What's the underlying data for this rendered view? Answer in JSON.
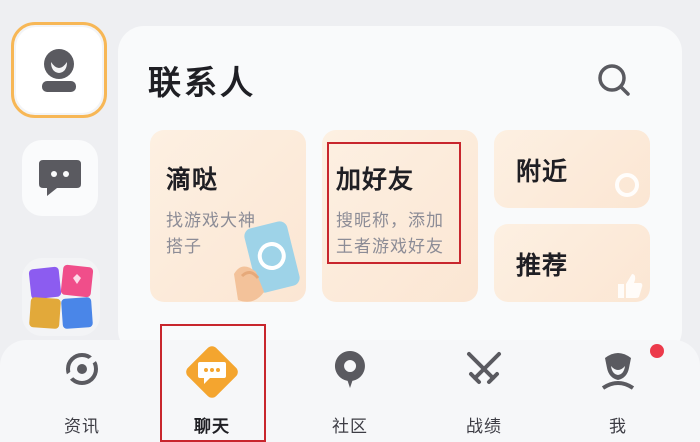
{
  "rail": {
    "items": [
      {
        "icon": "user-avatar-icon"
      },
      {
        "icon": "chat-bubble-icon"
      },
      {
        "icon": "game-tile-icon"
      }
    ]
  },
  "panel": {
    "title": "联系人",
    "search_icon": "search-icon",
    "cards": [
      {
        "title": "滴哒",
        "desc_line1": "找游戏大神",
        "desc_line2": "搭子"
      },
      {
        "title": "加好友",
        "desc_line1": "搜昵称，添加",
        "desc_line2": "王者游戏好友"
      },
      {
        "title": "附近"
      },
      {
        "title": "推荐"
      }
    ]
  },
  "tabbar": {
    "tabs": [
      {
        "label": "资讯",
        "icon": "news-icon"
      },
      {
        "label": "聊天",
        "icon": "chat-icon",
        "active": true
      },
      {
        "label": "社区",
        "icon": "community-icon"
      },
      {
        "label": "战绩",
        "icon": "crossed-swords-icon"
      },
      {
        "label": "我",
        "icon": "profile-icon",
        "badge": true
      }
    ]
  },
  "colors": {
    "accent": "#f7b756",
    "highlight": "#c8262d",
    "badge": "#ec3a4b"
  }
}
